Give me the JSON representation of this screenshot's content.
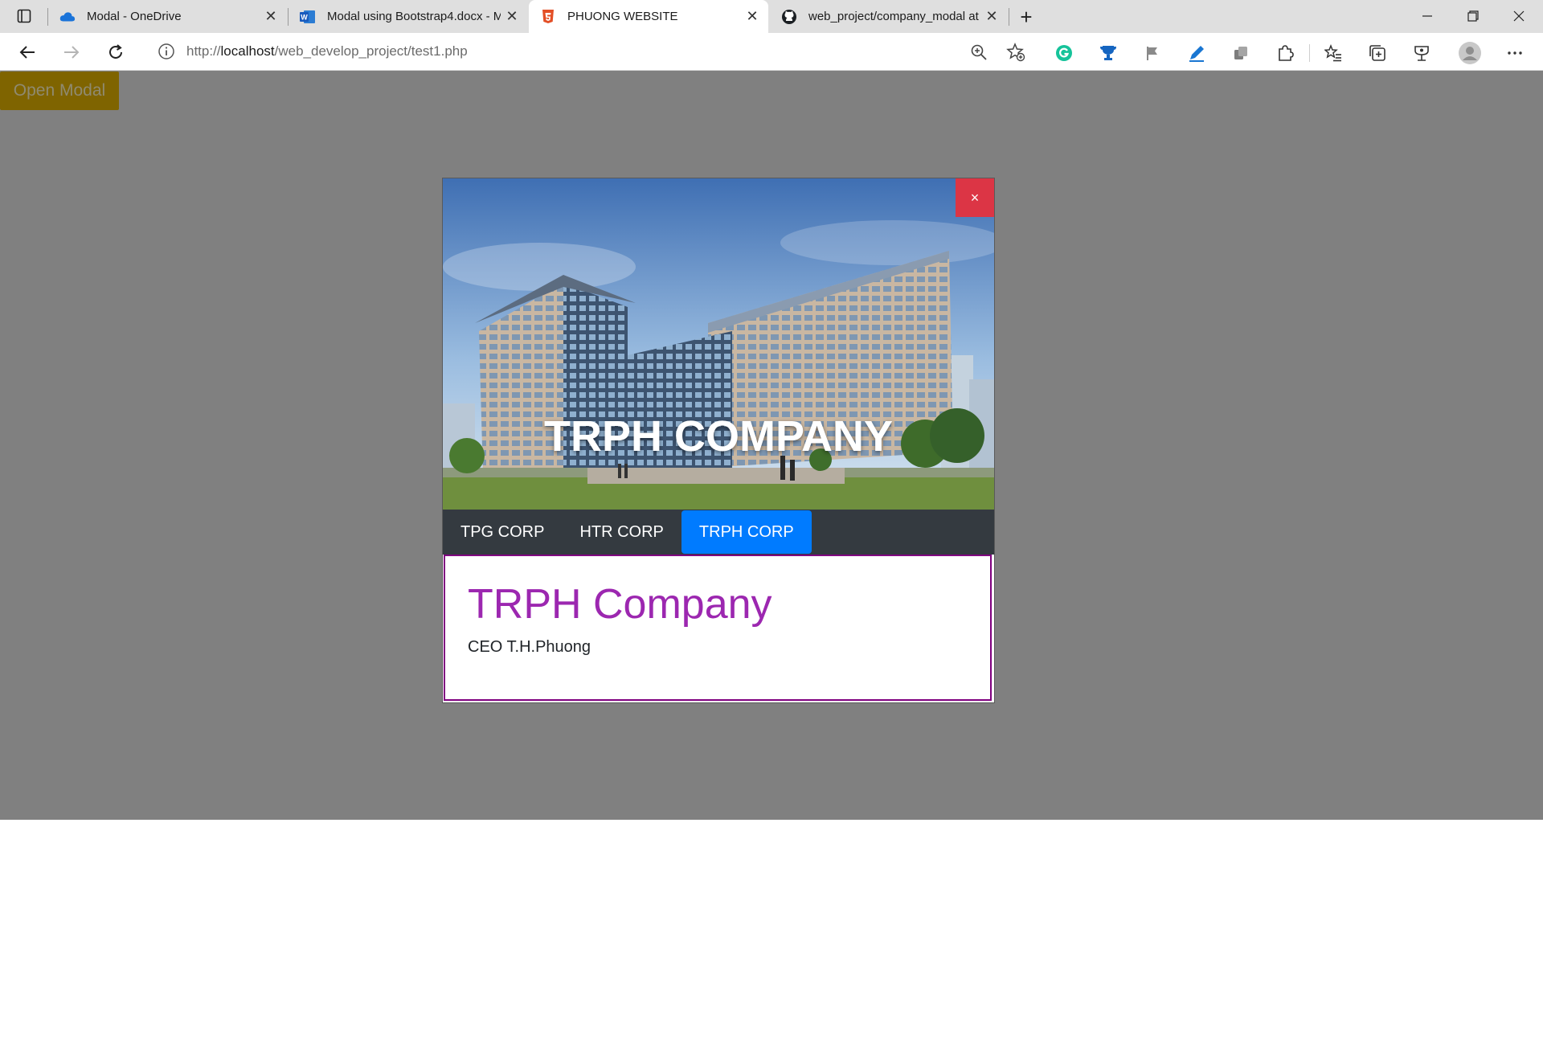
{
  "browser": {
    "tabs": [
      {
        "title": "Modal - OneDrive",
        "icon": "onedrive-icon",
        "active": false
      },
      {
        "title": "Modal using Bootstrap4.docx - M",
        "icon": "word-icon",
        "active": false
      },
      {
        "title": "PHUONG WEBSITE",
        "icon": "html5-icon",
        "active": true
      },
      {
        "title": "web_project/company_modal at",
        "icon": "github-icon",
        "active": false
      }
    ],
    "url_prefix": "http://",
    "url_host": "localhost",
    "url_path": "/web_develop_project/test1.php",
    "close_glyph": "✕",
    "new_tab_glyph": "+"
  },
  "page": {
    "open_modal_label": "Open Modal",
    "accent_colors": {
      "close": "#dc3545",
      "active_tab": "#007bff",
      "heading": "#9c27b0",
      "border": "#800080"
    }
  },
  "modal": {
    "hero_title": "TRPH COMPANY",
    "close_label": "×",
    "tabs": [
      {
        "label": "TPG CORP",
        "active": false
      },
      {
        "label": "HTR CORP",
        "active": false
      },
      {
        "label": "TRPH CORP",
        "active": true
      }
    ],
    "content": {
      "heading": "TRPH Company",
      "text": "CEO T.H.Phuong"
    }
  }
}
